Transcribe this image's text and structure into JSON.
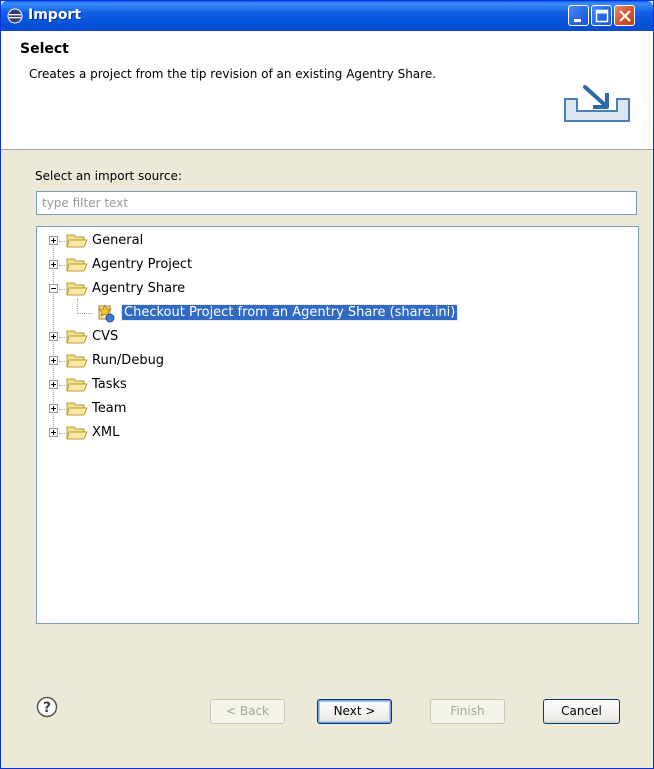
{
  "window": {
    "title": "Import"
  },
  "header": {
    "title": "Select",
    "description": "Creates a project from the tip revision of an existing Agentry Share."
  },
  "source": {
    "label": "Select an import source:",
    "filter_placeholder": "type filter text",
    "filter_value": ""
  },
  "tree": {
    "nodes": [
      {
        "label": "General",
        "expanded": false
      },
      {
        "label": "Agentry Project",
        "expanded": false
      },
      {
        "label": "Agentry Share",
        "expanded": true,
        "children": [
          {
            "label": "Checkout Project from an Agentry Share (share.ini)",
            "selected": true
          }
        ]
      },
      {
        "label": "CVS",
        "expanded": false
      },
      {
        "label": "Run/Debug",
        "expanded": false
      },
      {
        "label": "Tasks",
        "expanded": false
      },
      {
        "label": "Team",
        "expanded": false
      },
      {
        "label": "XML",
        "expanded": false
      }
    ]
  },
  "buttons": {
    "back": "< Back",
    "next": "Next >",
    "finish": "Finish",
    "cancel": "Cancel"
  },
  "colors": {
    "titlebar": "#0a5fe4",
    "selection": "#316ac5",
    "dialog_bg": "#ece9d8"
  }
}
